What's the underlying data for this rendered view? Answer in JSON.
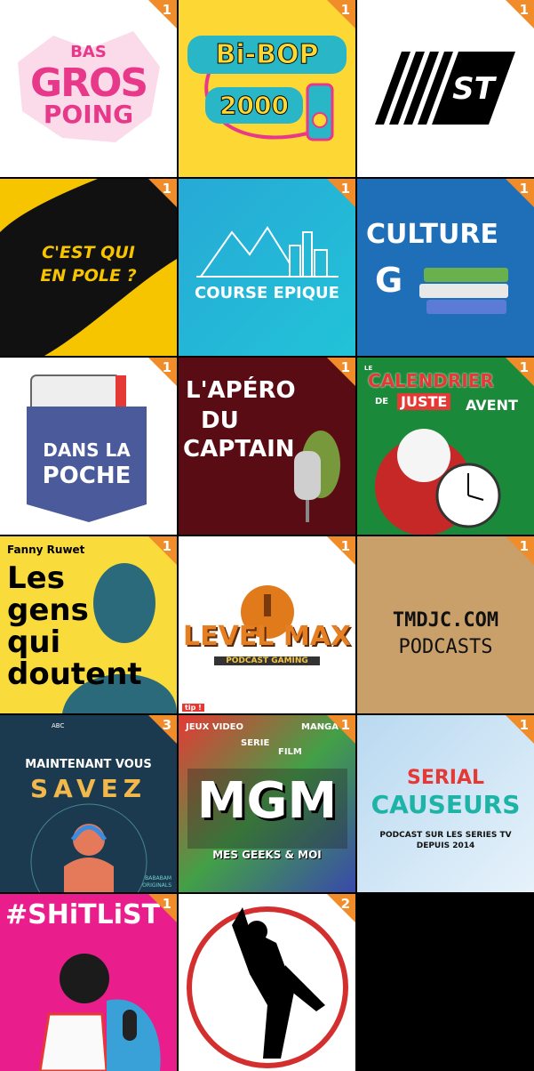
{
  "tiles": [
    {
      "badge": "1",
      "text": [
        "BAS",
        "GROS",
        "POING"
      ]
    },
    {
      "badge": "1",
      "text": [
        "Bi-BOP",
        "2000"
      ]
    },
    {
      "badge": "1",
      "text": [
        "ST"
      ]
    },
    {
      "badge": "1",
      "text": [
        "C'EST QUI",
        "EN POLE ?"
      ]
    },
    {
      "badge": "1",
      "text": [
        "COURSE EPIQUE"
      ]
    },
    {
      "badge": "1",
      "text": [
        "CULTURE",
        "G"
      ]
    },
    {
      "badge": "1",
      "text": [
        "DANS LA",
        "POCHE"
      ]
    },
    {
      "badge": "1",
      "text": [
        "L'APÉRO",
        "DU",
        "CAPTAIN"
      ]
    },
    {
      "badge": "1",
      "text": [
        "LE",
        "CALENDRIER",
        "DE",
        "JUSTE",
        "AVENT"
      ]
    },
    {
      "badge": "1",
      "text": [
        "Fanny Ruwet",
        "Les",
        "gens",
        "qui",
        "doutent"
      ]
    },
    {
      "badge": "1",
      "text": [
        "LEVEL MAX",
        "PODCAST GAMING",
        "tip !"
      ]
    },
    {
      "badge": "1",
      "text": [
        "TMDJC.COM",
        "PODCASTS"
      ]
    },
    {
      "badge": "3",
      "text": [
        "MAINTENANT VOUS",
        "SAVEZ",
        "ABC",
        "BABABAM",
        "ORIGINALS"
      ]
    },
    {
      "badge": "1",
      "text": [
        "JEUX VIDEO",
        "MANGA",
        "SERIE",
        "FILM",
        "MGM",
        "MES GEEKS & MOI"
      ]
    },
    {
      "badge": "1",
      "text": [
        "SERIAL",
        "CAUSEURS",
        "PODCAST SUR LES SERIES TV",
        "DEPUIS 2014"
      ]
    },
    {
      "badge": "1",
      "text": [
        "#SHiTLiST"
      ]
    },
    {
      "badge": "2",
      "text": []
    }
  ]
}
